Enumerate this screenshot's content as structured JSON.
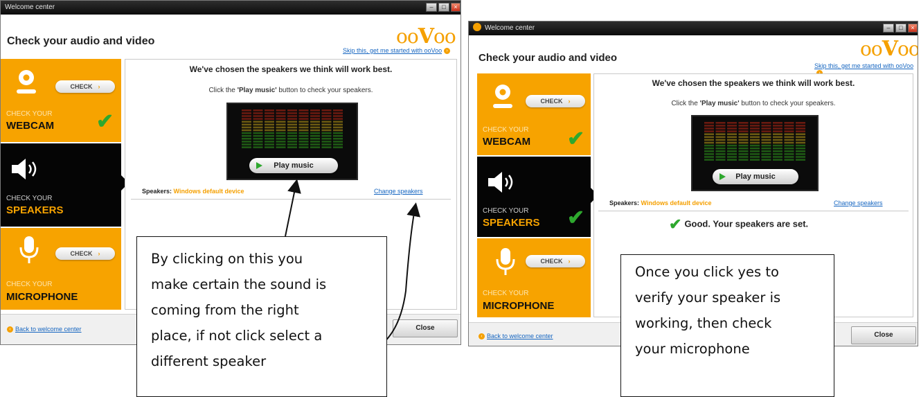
{
  "window_a": {
    "title": "Welcome center",
    "heading": "Check your audio and video",
    "brand": "ooVoo",
    "skip_link": "Skip this, get me started with ooVoo",
    "tiles": {
      "webcam": {
        "line1": "CHECK YOUR",
        "line2": "WEBCAM",
        "button": "CHECK"
      },
      "speakers": {
        "line1": "CHECK YOUR",
        "line2": "SPEAKERS"
      },
      "microphone": {
        "line1": "CHECK YOUR",
        "line2": "MICROPHONE",
        "button": "CHECK"
      }
    },
    "panel": {
      "title": "We've chosen the speakers we think will work best.",
      "instruction_pre": "Click the ",
      "instruction_bold": "'Play music'",
      "instruction_post": " button to check your speakers.",
      "play_button": "Play music",
      "speakers_label": "Speakers:",
      "speakers_value": "Windows default device",
      "change_link": "Change speakers"
    },
    "back_link": "Back to welcome center",
    "close_button": "Close"
  },
  "window_b": {
    "title": "Welcome center",
    "heading": "Check your audio and video",
    "brand": "ooVoo",
    "skip_link": "Skip this, get me started with ooVoo",
    "tiles": {
      "webcam": {
        "line1": "CHECK YOUR",
        "line2": "WEBCAM",
        "button": "CHECK"
      },
      "speakers": {
        "line1": "CHECK YOUR",
        "line2": "SPEAKERS"
      },
      "microphone": {
        "line1": "CHECK YOUR",
        "line2": "MICROPHONE",
        "button": "CHECK"
      }
    },
    "panel": {
      "title": "We've chosen the speakers we think will work best.",
      "instruction_pre": "Click the ",
      "instruction_bold": "'Play music'",
      "instruction_post": " button to check your speakers.",
      "play_button": "Play music",
      "speakers_label": "Speakers:",
      "speakers_value": "Windows default device",
      "change_link": "Change speakers",
      "good_message": "Good. Your speakers are set."
    },
    "back_link": "Back to welcome center",
    "close_button": "Close"
  },
  "callouts": {
    "left": [
      "By clicking on this you",
      "make certain the sound is",
      "coming from the right",
      "place, if not click select a",
      "different speaker"
    ],
    "right": [
      "Once you click yes to",
      "verify your speaker is",
      "working, then check",
      "your microphone"
    ]
  },
  "colors": {
    "accent": "#f7a300",
    "link": "#1565c0",
    "success": "#2ea82e",
    "tile_dark": "#050505"
  }
}
